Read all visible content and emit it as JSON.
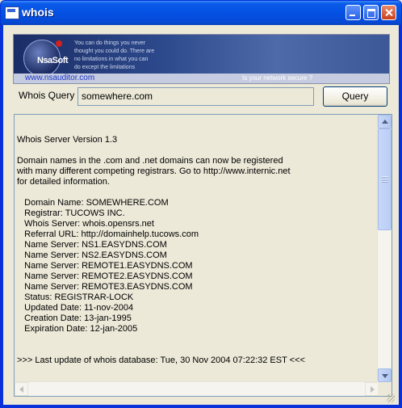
{
  "window": {
    "title": "whois"
  },
  "banner": {
    "logo": "NsaSoft",
    "slogan": "You can do things you never thought you could do. There are no limitations in what you can do except the limitations",
    "site": "www.nsauditor.com",
    "tagline": "Is your network secure ?"
  },
  "query": {
    "label": "Whois Query :",
    "value": "somewhere.com",
    "button": "Query"
  },
  "result": {
    "text": "Whois Server Version 1.3\n\nDomain names in the .com and .net domains can now be registered\nwith many different competing registrars. Go to http://www.internic.net\nfor detailed information.\n\n   Domain Name: SOMEWHERE.COM\n   Registrar: TUCOWS INC.\n   Whois Server: whois.opensrs.net\n   Referral URL: http://domainhelp.tucows.com\n   Name Server: NS1.EASYDNS.COM\n   Name Server: NS2.EASYDNS.COM\n   Name Server: REMOTE1.EASYDNS.COM\n   Name Server: REMOTE2.EASYDNS.COM\n   Name Server: REMOTE3.EASYDNS.COM\n   Status: REGISTRAR-LOCK\n   Updated Date: 11-nov-2004\n   Creation Date: 13-jan-1995\n   Expiration Date: 12-jan-2005\n\n\n>>> Last update of whois database: Tue, 30 Nov 2004 07:22:32 EST <<<"
  },
  "colors": {
    "titlebar": "#0551e3",
    "face": "#ece9d8",
    "link": "#1d35c8"
  }
}
